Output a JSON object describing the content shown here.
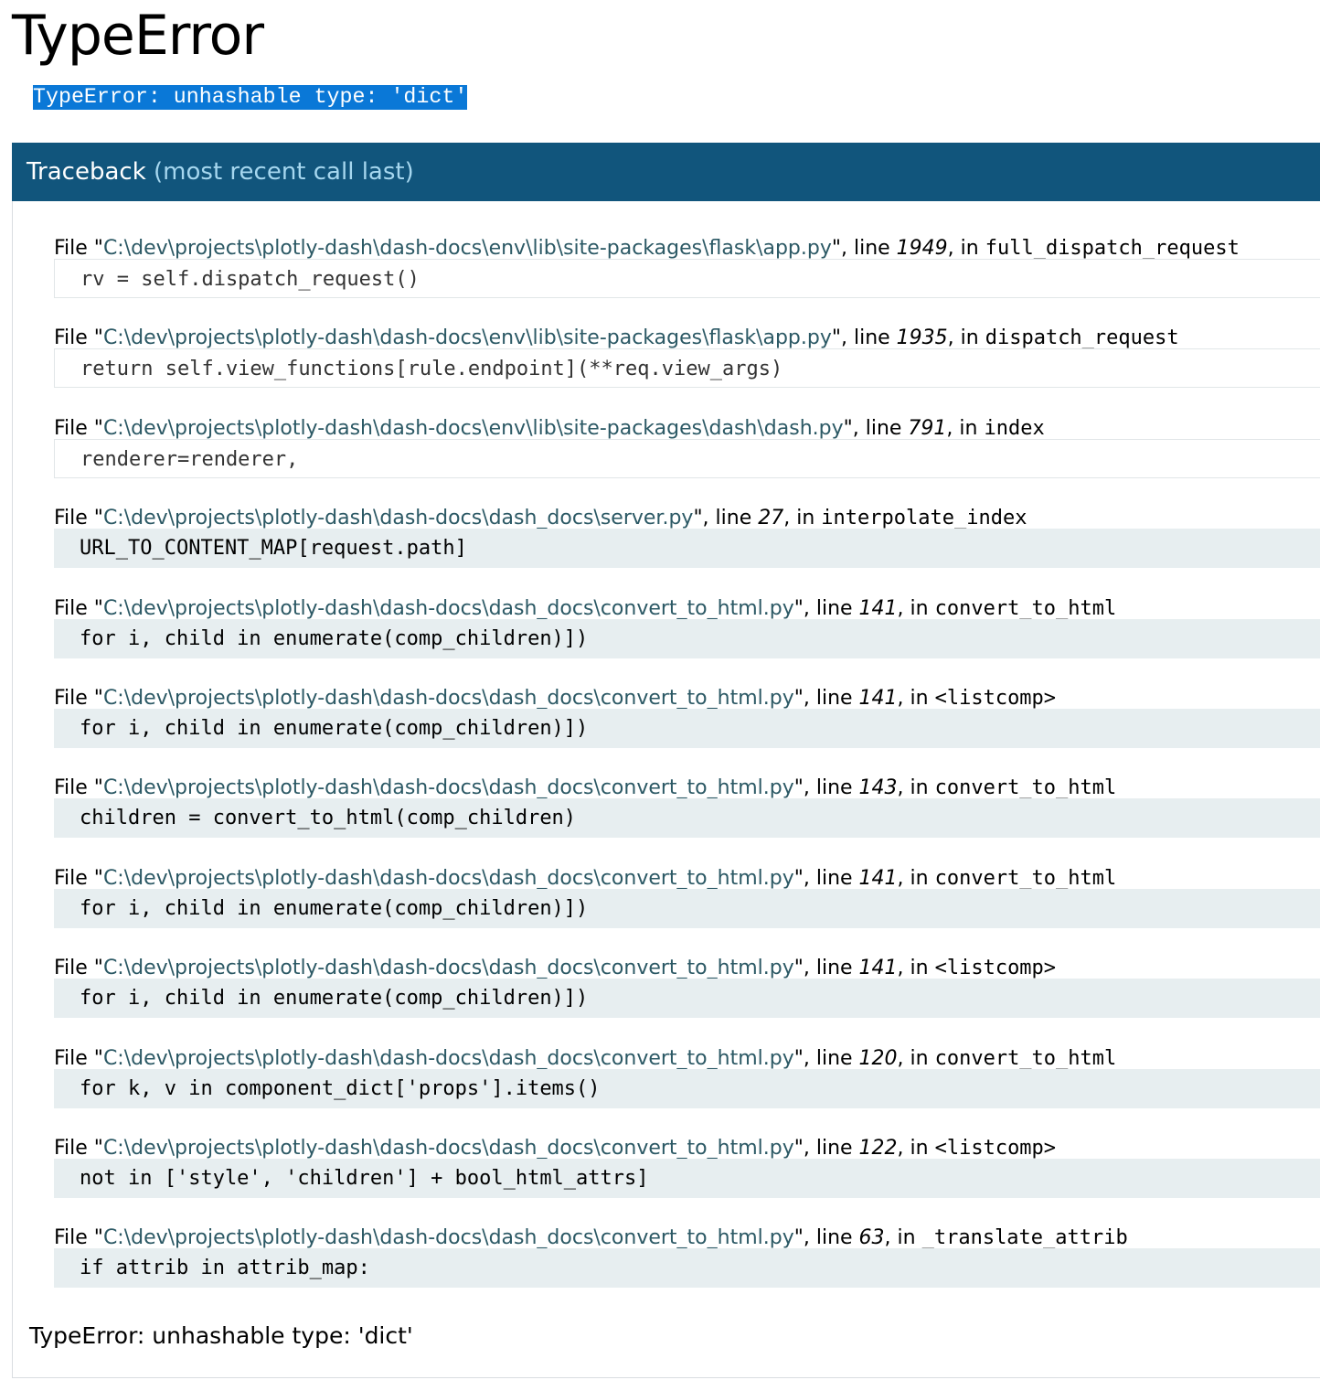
{
  "title": "TypeError",
  "error_message": "TypeError: unhashable type: 'dict'",
  "traceback": {
    "header": "Traceback",
    "header_sub": "(most recent call last)",
    "frames": [
      {
        "file": "C:\\dev\\projects\\plotly-dash\\dash-docs\\env\\lib\\site-packages\\flask\\app.py",
        "line": "1949",
        "func": "full_dispatch_request",
        "code": "rv = self.dispatch_request()",
        "library": true
      },
      {
        "file": "C:\\dev\\projects\\plotly-dash\\dash-docs\\env\\lib\\site-packages\\flask\\app.py",
        "line": "1935",
        "func": "dispatch_request",
        "code": "return self.view_functions[rule.endpoint](**req.view_args)",
        "library": true
      },
      {
        "file": "C:\\dev\\projects\\plotly-dash\\dash-docs\\env\\lib\\site-packages\\dash\\dash.py",
        "line": "791",
        "func": "index",
        "code": "renderer=renderer,",
        "library": true
      },
      {
        "file": "C:\\dev\\projects\\plotly-dash\\dash-docs\\dash_docs\\server.py",
        "line": "27",
        "func": "interpolate_index",
        "code": "URL_TO_CONTENT_MAP[request.path]",
        "library": false
      },
      {
        "file": "C:\\dev\\projects\\plotly-dash\\dash-docs\\dash_docs\\convert_to_html.py",
        "line": "141",
        "func": "convert_to_html",
        "code": "for i, child in enumerate(comp_children)])",
        "library": false
      },
      {
        "file": "C:\\dev\\projects\\plotly-dash\\dash-docs\\dash_docs\\convert_to_html.py",
        "line": "141",
        "func": "<listcomp>",
        "code": "for i, child in enumerate(comp_children)])",
        "library": false
      },
      {
        "file": "C:\\dev\\projects\\plotly-dash\\dash-docs\\dash_docs\\convert_to_html.py",
        "line": "143",
        "func": "convert_to_html",
        "code": "children = convert_to_html(comp_children)",
        "library": false
      },
      {
        "file": "C:\\dev\\projects\\plotly-dash\\dash-docs\\dash_docs\\convert_to_html.py",
        "line": "141",
        "func": "convert_to_html",
        "code": "for i, child in enumerate(comp_children)])",
        "library": false
      },
      {
        "file": "C:\\dev\\projects\\plotly-dash\\dash-docs\\dash_docs\\convert_to_html.py",
        "line": "141",
        "func": "<listcomp>",
        "code": "for i, child in enumerate(comp_children)])",
        "library": false
      },
      {
        "file": "C:\\dev\\projects\\plotly-dash\\dash-docs\\dash_docs\\convert_to_html.py",
        "line": "120",
        "func": "convert_to_html",
        "code": "for k, v in component_dict['props'].items()",
        "library": false
      },
      {
        "file": "C:\\dev\\projects\\plotly-dash\\dash-docs\\dash_docs\\convert_to_html.py",
        "line": "122",
        "func": "<listcomp>",
        "code": "not in ['style', 'children'] + bool_html_attrs]",
        "library": false
      },
      {
        "file": "C:\\dev\\projects\\plotly-dash\\dash-docs\\dash_docs\\convert_to_html.py",
        "line": "63",
        "func": "_translate_attrib",
        "code": "if attrib in attrib_map:",
        "library": false
      }
    ],
    "labels": {
      "file_prefix": "File \"",
      "line_prefix": "\", line ",
      "in_prefix": ", in "
    }
  },
  "final_error": "TypeError: unhashable type: 'dict'",
  "colors": {
    "header_bg": "#11557c",
    "header_sub": "#a6d7ef",
    "selection": "#0a78d7",
    "code_bg": "#e7eef0",
    "path": "#2c5965"
  }
}
